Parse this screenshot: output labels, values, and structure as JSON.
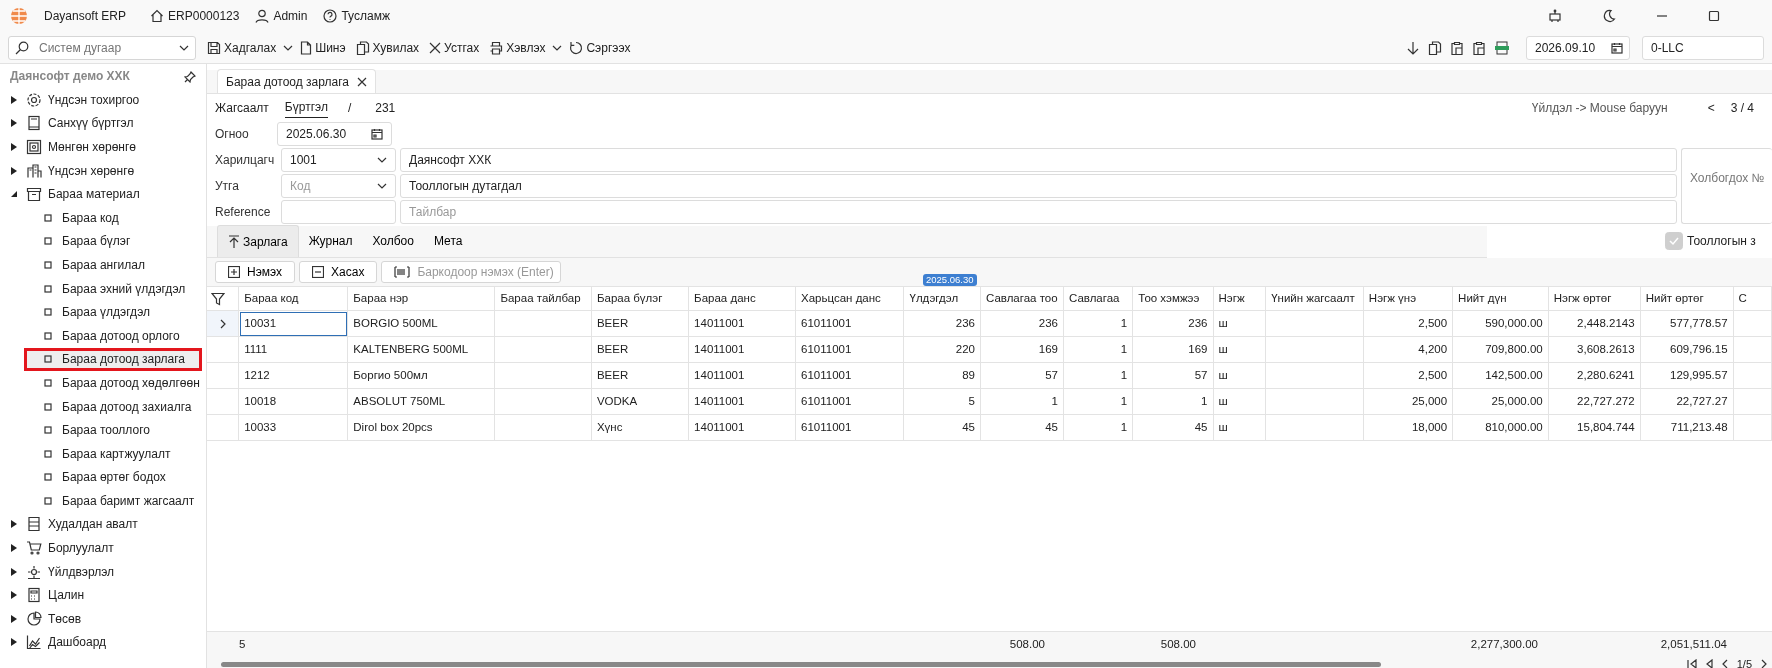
{
  "app": {
    "title": "Dayansoft ERP",
    "doc_no": "ERP0000123",
    "user": "Admin",
    "help": "Тусламж"
  },
  "toolbar": {
    "search_placeholder": "Систем дугаар",
    "actions": [
      {
        "label": "Хадгалах",
        "dropdown": true
      },
      {
        "label": "Шинэ",
        "dropdown": false
      },
      {
        "label": "Хувилах",
        "dropdown": false
      },
      {
        "label": "Устгах",
        "dropdown": false
      },
      {
        "label": "Хэвлэх",
        "dropdown": true
      },
      {
        "label": "Сэргээх",
        "dropdown": false
      }
    ],
    "date": "2026.09.10",
    "company": "0-LLC"
  },
  "sidebar": {
    "title": "Даянсофт демо ХХК",
    "items": [
      {
        "label": "Үндсэн тохиргоо",
        "expanded": false
      },
      {
        "label": "Санхүү бүртгэл",
        "expanded": false
      },
      {
        "label": "Мөнгөн хөрөнгө",
        "expanded": false
      },
      {
        "label": "Үндсэн хөрөнгө",
        "expanded": false
      },
      {
        "label": "Бараа материал",
        "expanded": true,
        "children": [
          {
            "label": "Бараа код",
            "selected": false
          },
          {
            "label": "Бараа бүлэг",
            "selected": false
          },
          {
            "label": "Бараа ангилал",
            "selected": false
          },
          {
            "label": "Бараа эхний үлдэгдэл",
            "selected": false
          },
          {
            "label": "Бараа үлдэгдэл",
            "selected": false
          },
          {
            "label": "Бараа дотоод орлого",
            "selected": false
          },
          {
            "label": "Бараа дотоод зарлага",
            "selected": true
          },
          {
            "label": "Бараа дотоод хөдөлгөөн",
            "selected": false
          },
          {
            "label": "Бараа дотоод захиалга",
            "selected": false
          },
          {
            "label": "Бараа тооллого",
            "selected": false
          },
          {
            "label": "Бараа картжуулалт",
            "selected": false
          },
          {
            "label": "Бараа өртөг бодох",
            "selected": false
          },
          {
            "label": "Бараа баримт жагсаалт",
            "selected": false
          }
        ]
      },
      {
        "label": "Худалдан авалт",
        "expanded": false
      },
      {
        "label": "Борлуулалт",
        "expanded": false
      },
      {
        "label": "Үйлдвэрлэл",
        "expanded": false
      },
      {
        "label": "Цалин",
        "expanded": false
      },
      {
        "label": "Төсөв",
        "expanded": false
      },
      {
        "label": "Дашбоард",
        "expanded": false
      }
    ]
  },
  "document_tab": {
    "label": "Бараа дотоод зарлага"
  },
  "breadcrumb": [
    {
      "label": "Жагсаалт",
      "selected": false
    },
    {
      "label": "Бүртгэл",
      "selected": true
    }
  ],
  "separator": "/",
  "record_id": "231",
  "record_nav": {
    "hint": "Үйлдэл -> Mouse баруун",
    "prev": "<",
    "position": "3 / 4"
  },
  "form": {
    "date_label": "Огноо",
    "date": "2025.06.30",
    "partner_label": "Харилцагч",
    "partner_code": "1001",
    "partner_name": "Даянсофт ХХК",
    "value_label": "Утга",
    "value_code_placeholder": "Код",
    "value_text": "Тооллогын дутагдал",
    "reference_label": "Reference",
    "description_placeholder": "Тайлбар",
    "related_label": "Холбогдох №",
    "inventory_check": {
      "label": "Тооллогын з",
      "checked": true
    }
  },
  "subtabs": [
    {
      "label": "Зарлага",
      "selected": true
    },
    {
      "label": "Журнал",
      "selected": false
    },
    {
      "label": "Холбоо",
      "selected": false
    },
    {
      "label": "Мета",
      "selected": false
    }
  ],
  "grid_actions": [
    {
      "label": "Нэмэх",
      "kind": "add"
    },
    {
      "label": "Хасах",
      "kind": "remove"
    }
  ],
  "barcode_placeholder": "Баркодоор нэмэх (Enter)",
  "table": {
    "date_badge": "2025.06.30",
    "columns": [
      {
        "label": "Бараа код"
      },
      {
        "label": "Бараа нэр"
      },
      {
        "label": "Бараа тайлбар"
      },
      {
        "label": "Бараа бүлэг"
      },
      {
        "label": "Бараа данс"
      },
      {
        "label": "Харьцсан данс"
      },
      {
        "label": "Үлдэгдэл"
      },
      {
        "label": "Савлагаа тоо"
      },
      {
        "label": "Савлагаа"
      },
      {
        "label": "Тоо хэмжээ"
      },
      {
        "label": "Нэгж"
      },
      {
        "label": "Үнийн жагсаалт"
      },
      {
        "label": "Нэгж үнэ"
      },
      {
        "label": "Нийт дүн"
      },
      {
        "label": "Нэгж өртөг"
      },
      {
        "label": "Нийт өртөг"
      },
      {
        "label": "С"
      }
    ],
    "rows": [
      {
        "selected": true,
        "code": "10031",
        "name": "BORGIO 500ML",
        "group": "BEER",
        "account": "14011001",
        "contra_account": "61011001",
        "balance": "236",
        "package_qty": "236",
        "package": "1",
        "quantity": "236",
        "unit": "ш",
        "unit_price": "2,500",
        "amount": "590,000.00",
        "unit_cost": "2,448.2143",
        "total_cost": "577,778.57"
      },
      {
        "selected": false,
        "code": "1111",
        "name": "KALTENBERG 500ML",
        "group": "BEER",
        "account": "14011001",
        "contra_account": "61011001",
        "balance": "220",
        "package_qty": "169",
        "package": "1",
        "quantity": "169",
        "unit": "ш",
        "unit_price": "4,200",
        "amount": "709,800.00",
        "unit_cost": "3,608.2613",
        "total_cost": "609,796.15"
      },
      {
        "selected": false,
        "code": "1212",
        "name": "Боргио 500мл",
        "group": "BEER",
        "account": "14011001",
        "contra_account": "61011001",
        "balance": "89",
        "package_qty": "57",
        "package": "1",
        "quantity": "57",
        "unit": "ш",
        "unit_price": "2,500",
        "amount": "142,500.00",
        "unit_cost": "2,280.6241",
        "total_cost": "129,995.57"
      },
      {
        "selected": false,
        "code": "10018",
        "name": "ABSOLUT 750ML",
        "group": "VODKA",
        "account": "14011001",
        "contra_account": "61011001",
        "balance": "5",
        "package_qty": "1",
        "package": "1",
        "quantity": "1",
        "unit": "ш",
        "unit_price": "25,000",
        "amount": "25,000.00",
        "unit_cost": "22,727.272",
        "total_cost": "22,727.27"
      },
      {
        "selected": false,
        "code": "10033",
        "name": "Dirol box 20pcs",
        "group": "Хүнс",
        "account": "14011001",
        "contra_account": "61011001",
        "balance": "45",
        "package_qty": "45",
        "package": "1",
        "quantity": "45",
        "unit": "ш",
        "unit_price": "18,000",
        "amount": "810,000.00",
        "unit_cost": "15,804.744",
        "total_cost": "711,213.48"
      }
    ],
    "footer": {
      "count": "5",
      "package_qty": "508.00",
      "quantity": "508.00",
      "amount": "2,277,300.00",
      "total_cost": "2,051,511.04"
    },
    "pager": "1/5"
  }
}
